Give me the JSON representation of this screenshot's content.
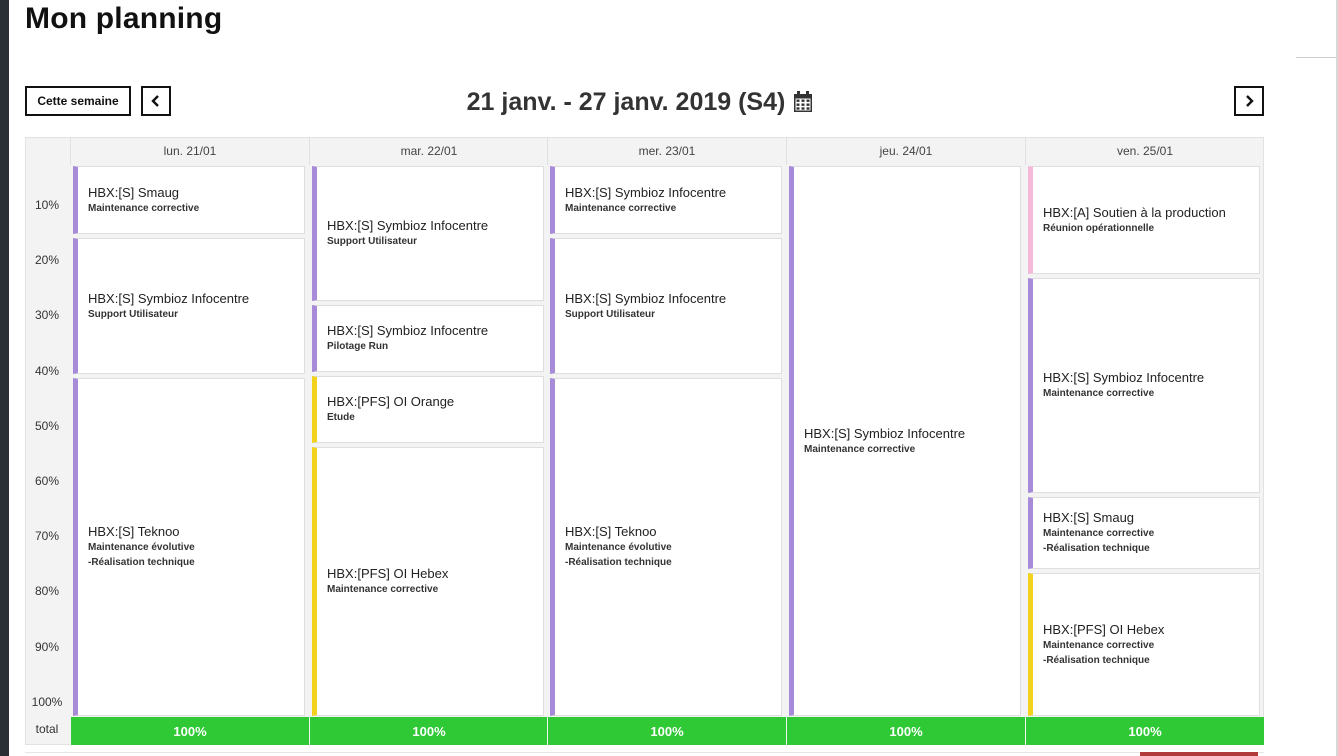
{
  "page": {
    "title": "Mon planning"
  },
  "toolbar": {
    "this_week_label": "Cette semaine",
    "week_range": "21 janv. - 27 janv. 2019 (S4)"
  },
  "rows": [
    "10%",
    "20%",
    "30%",
    "40%",
    "50%",
    "60%",
    "70%",
    "80%",
    "90%",
    "100%"
  ],
  "total_label": "total",
  "days": [
    {
      "label": "lun. 21/01",
      "total": "100%",
      "events": [
        {
          "title": "HBX:[S] Smaug",
          "lines": [
            "Maintenance corrective"
          ],
          "share": 0.125,
          "color": "#a78bd8"
        },
        {
          "title": "HBX:[S] Symbioz Infocentre",
          "lines": [
            "Support Utilisateur"
          ],
          "share": 0.25,
          "color": "#a78bd8"
        },
        {
          "title": "HBX:[S] Teknoo",
          "lines": [
            "Maintenance évolutive",
            "-Réalisation technique"
          ],
          "share": 0.625,
          "color": "#a78bd8"
        }
      ]
    },
    {
      "label": "mar. 22/01",
      "total": "100%",
      "events": [
        {
          "title": "HBX:[S] Symbioz Infocentre",
          "lines": [
            "Support Utilisateur"
          ],
          "share": 0.25,
          "color": "#a78bd8"
        },
        {
          "title": "HBX:[S] Symbioz Infocentre",
          "lines": [
            "Pilotage Run"
          ],
          "share": 0.125,
          "color": "#a78bd8"
        },
        {
          "title": "HBX:[PFS] OI Orange",
          "lines": [
            "Etude"
          ],
          "share": 0.125,
          "color": "#f2d21c"
        },
        {
          "title": "HBX:[PFS] OI Hebex",
          "lines": [
            "Maintenance corrective"
          ],
          "share": 0.5,
          "color": "#f2d21c"
        }
      ]
    },
    {
      "label": "mer. 23/01",
      "total": "100%",
      "events": [
        {
          "title": "HBX:[S] Symbioz Infocentre",
          "lines": [
            "Maintenance corrective"
          ],
          "share": 0.125,
          "color": "#a78bd8"
        },
        {
          "title": "HBX:[S] Symbioz Infocentre",
          "lines": [
            "Support Utilisateur"
          ],
          "share": 0.25,
          "color": "#a78bd8"
        },
        {
          "title": "HBX:[S] Teknoo",
          "lines": [
            "Maintenance évolutive",
            "-Réalisation technique"
          ],
          "share": 0.625,
          "color": "#a78bd8"
        }
      ]
    },
    {
      "label": "jeu. 24/01",
      "total": "100%",
      "events": [
        {
          "title": "HBX:[S] Symbioz Infocentre",
          "lines": [
            "Maintenance corrective"
          ],
          "share": 1.0,
          "color": "#a78bd8"
        }
      ]
    },
    {
      "label": "ven. 25/01",
      "total": "100%",
      "events": [
        {
          "title": "HBX:[A] Soutien à la production",
          "lines": [
            "Réunion opérationnelle"
          ],
          "share": 0.2,
          "color": "#f5b8d8"
        },
        {
          "title": "HBX:[S] Symbioz Infocentre",
          "lines": [
            "Maintenance corrective"
          ],
          "share": 0.4,
          "color": "#a78bd8"
        },
        {
          "title": "HBX:[S] Smaug",
          "lines": [
            "Maintenance corrective",
            "-Réalisation technique"
          ],
          "share": 0.133,
          "color": "#a78bd8"
        },
        {
          "title": "HBX:[PFS] OI Hebex",
          "lines": [
            "Maintenance corrective",
            "-Réalisation technique"
          ],
          "share": 0.267,
          "color": "#f2d21c"
        }
      ]
    }
  ]
}
